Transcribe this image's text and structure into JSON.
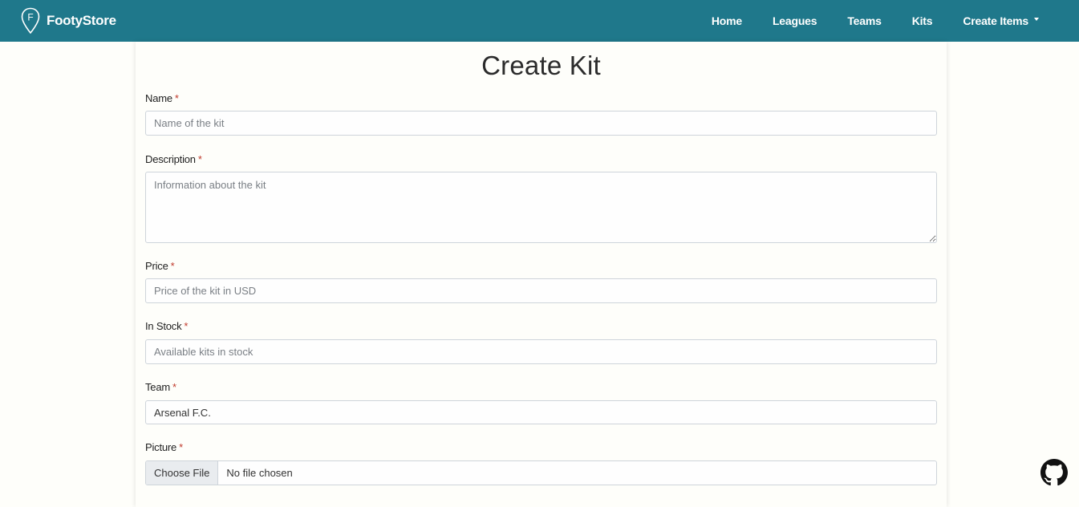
{
  "navbar": {
    "brand": "FootyStore",
    "brand_icon_letter": "F",
    "links": [
      {
        "label": "Home"
      },
      {
        "label": "Leagues"
      },
      {
        "label": "Teams"
      },
      {
        "label": "Kits"
      },
      {
        "label": "Create Items"
      }
    ],
    "icon": "location-pin-icon",
    "dropdown_icon": "caret-down-icon"
  },
  "form": {
    "title": "Create Kit",
    "required_marker": "*",
    "name": {
      "label": "Name",
      "placeholder": "Name of the kit",
      "value": ""
    },
    "description": {
      "label": "Description",
      "placeholder": "Information about the kit",
      "value": ""
    },
    "price": {
      "label": "Price",
      "placeholder": "Price of the kit in USD",
      "value": ""
    },
    "in_stock": {
      "label": "In Stock",
      "placeholder": "Available kits in stock",
      "value": ""
    },
    "team": {
      "label": "Team",
      "selected": "Arsenal F.C."
    },
    "picture": {
      "label": "Picture",
      "button": "Choose File",
      "status": "No file chosen"
    }
  },
  "footer": {
    "icon": "github-icon"
  },
  "colors": {
    "navbar_bg": "#1f788b",
    "page_bg": "#fefefa",
    "required": "#c0392b"
  }
}
